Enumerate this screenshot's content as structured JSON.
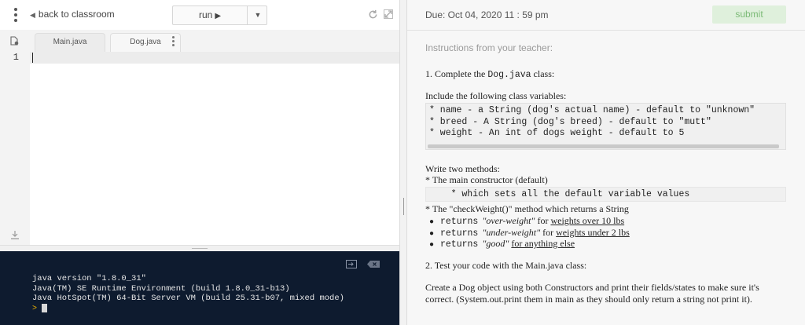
{
  "editor": {
    "back_label": "back to classroom",
    "run_label": "run",
    "run_icon": "play-icon",
    "tabs": [
      {
        "label": "Main.java"
      },
      {
        "label": "Dog.java"
      }
    ],
    "line_numbers": [
      "1"
    ]
  },
  "console": {
    "lines": [
      "java version \"1.8.0_31\"",
      "Java(TM) SE Runtime Environment (build 1.8.0_31-b13)",
      "Java HotSpot(TM) 64-Bit Server VM (build 25.31-b07, mixed mode)"
    ],
    "prompt": ">"
  },
  "assignment": {
    "due": "Due: Oct 04, 2020 11 : 59 pm",
    "submit_label": "submit",
    "instructions_label": "Instructions from your teacher:",
    "step1_prefix": "1. Complete the ",
    "step1_code": "Dog.java",
    "step1_suffix": " class:",
    "include_text": "Include the following class variables:",
    "class_vars": [
      "* name - a String (dog's actual name) - default to \"unknown\"",
      "* breed - A String (dog's breed) - default to \"mutt\"",
      "* weight - An int of dogs weight - default to 5"
    ],
    "write_text": "Write two methods:",
    "ctor_text": "* The main constructor (default)",
    "ctor_code": "    * which sets all the default variable values",
    "check_text": "* The \"checkWeight()\" method which returns a String",
    "returns": [
      {
        "kw": "returns",
        "value": "\"over-weight\"",
        "mid": " for ",
        "cond": "weights over 10 lbs"
      },
      {
        "kw": "returns",
        "value": "\"under-weight\"",
        "mid": " for ",
        "cond": "weights under 2 lbs"
      },
      {
        "kw": "returns",
        "value": "\"good\"",
        "mid": " ",
        "cond": "for anything else"
      }
    ],
    "step2": "2. Test your code with the Main.java class:",
    "create_text": "Create a Dog object using both Constructors and print their fields/states to make sure it's correct. (System.out.print them in main as they should only return a string not print it)."
  },
  "colors": {
    "console_bg": "#0e1b2f",
    "submit_bg": "#dff0dc",
    "submit_text": "#7bba76",
    "prompt": "#f0b400"
  }
}
